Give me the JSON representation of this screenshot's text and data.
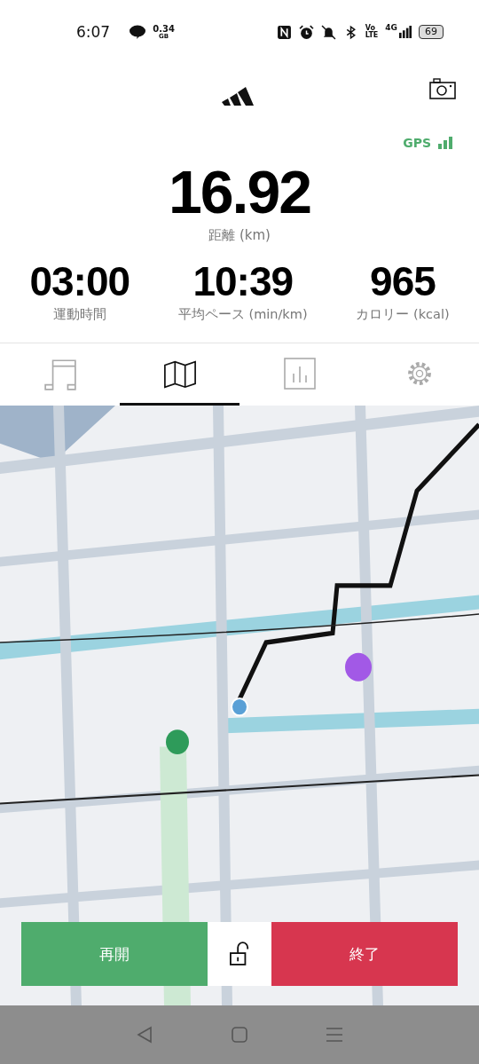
{
  "status_bar": {
    "time": "6:07",
    "data_value": "0.34",
    "data_unit": "GB",
    "volte_top": "Vo",
    "volte_bottom": "LTE",
    "network": "4G",
    "battery": "69"
  },
  "gps": {
    "label": "GPS"
  },
  "distance": {
    "value": "16.92",
    "label": "距離 (km)"
  },
  "stats": [
    {
      "value": "03:00",
      "label": "運動時間"
    },
    {
      "value": "10:39",
      "label": "平均ペース (min/km)"
    },
    {
      "value": "965",
      "label": "カロリー (kcal)"
    }
  ],
  "tabs": [
    {
      "kind": "music",
      "selected": false
    },
    {
      "kind": "map",
      "selected": true
    },
    {
      "kind": "chart",
      "selected": false
    },
    {
      "kind": "settings",
      "selected": false
    }
  ],
  "actions": [
    {
      "kind": "resume",
      "label": "再開"
    },
    {
      "kind": "lock"
    },
    {
      "kind": "finish",
      "label": "終了"
    }
  ]
}
